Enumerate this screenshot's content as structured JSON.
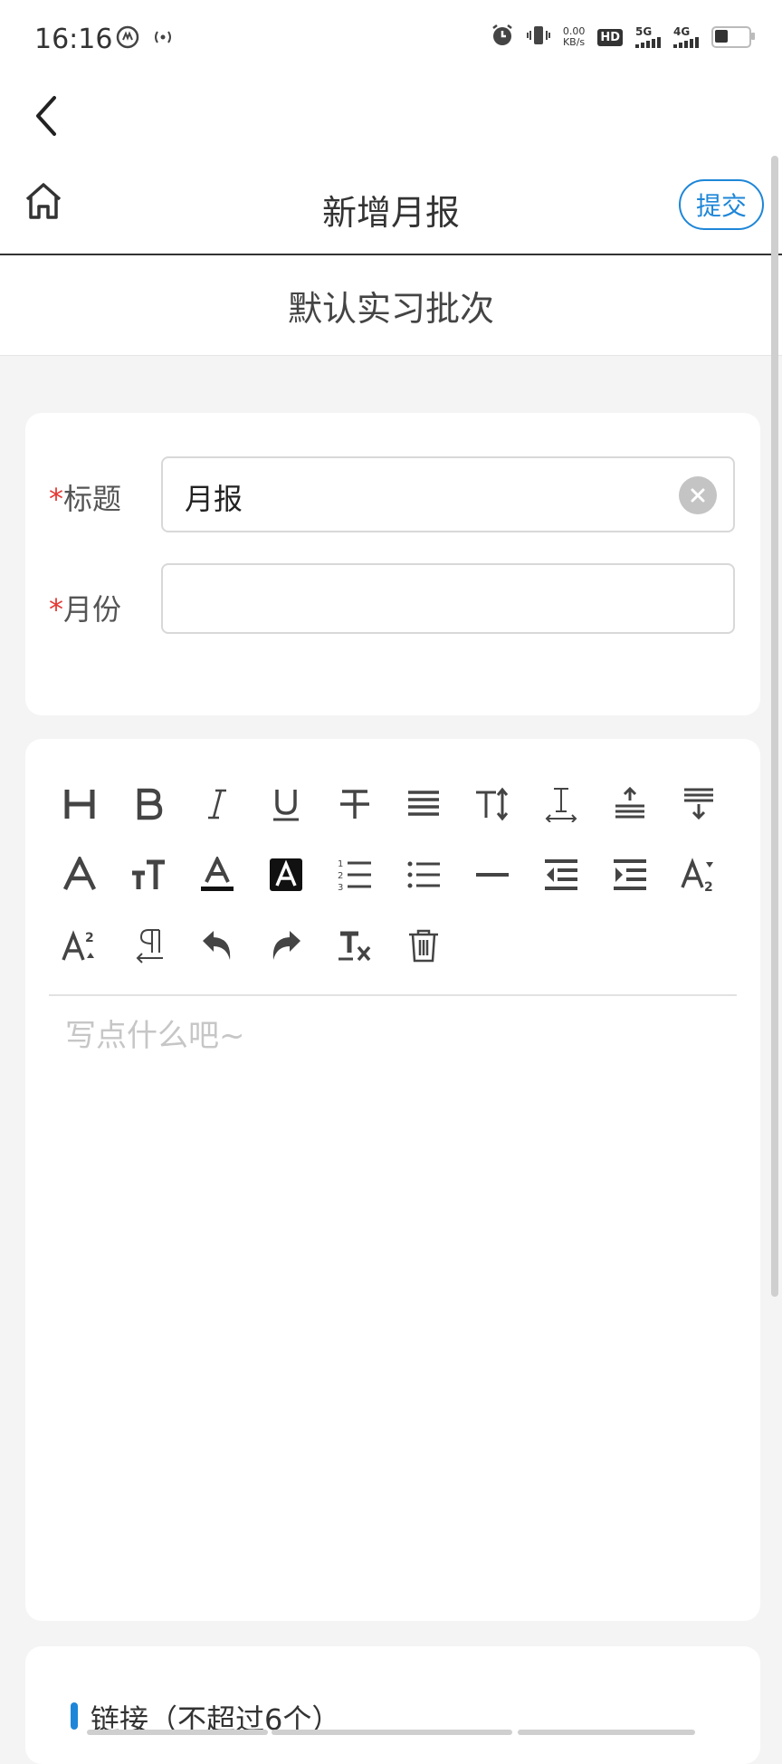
{
  "status_bar": {
    "time": "16:16",
    "net_speed_value": "0.00",
    "net_speed_unit": "KB/s",
    "hd_label": "HD",
    "sig1_label": "5G",
    "sig2_label": "4G"
  },
  "header": {
    "title": "新增月报",
    "submit_label": "提交"
  },
  "batch": {
    "name": "默认实习批次"
  },
  "form": {
    "required_mark": "*",
    "title_label": "标题",
    "title_value": "月报",
    "month_label": "月份",
    "month_value": ""
  },
  "editor": {
    "placeholder": "写点什么吧~",
    "tools": [
      "heading",
      "bold",
      "italic",
      "underline",
      "strikethrough",
      "align",
      "font-size",
      "letter-spacing",
      "line-height-up",
      "line-height-down",
      "font",
      "text-size-toggle",
      "font-color",
      "background-color",
      "ordered-list",
      "unordered-list",
      "horizontal-rule",
      "outdent",
      "indent",
      "subscript",
      "superscript",
      "paragraph-direction",
      "undo",
      "redo",
      "clear-format",
      "delete"
    ]
  },
  "links": {
    "title": "链接（不超过6个）"
  },
  "colors": {
    "accent": "#1e86d8",
    "required": "#e53935",
    "background": "#f4f4f4"
  }
}
